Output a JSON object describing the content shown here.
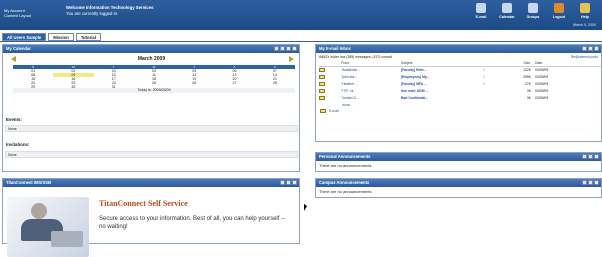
{
  "header": {
    "account_line1": "My Account",
    "account_line2": "Content Layout",
    "welcome_title": "Welcome Information Technology Services",
    "welcome_sub": "You are currently logged in.",
    "nav": [
      {
        "label": "E-mail",
        "icon": "email-icon",
        "color": "#c9d7ee"
      },
      {
        "label": "Calendar",
        "icon": "calendar-icon",
        "color": "#c9d7ee"
      },
      {
        "label": "Groups",
        "icon": "groups-icon",
        "color": "#c9d7ee"
      },
      {
        "label": "Logout",
        "icon": "logout-icon",
        "color": "#e08a2c"
      },
      {
        "label": "Help",
        "icon": "help-icon",
        "color": "#e9c24a"
      }
    ],
    "date": "March 9, 2009"
  },
  "tabs": [
    "All Users Sample",
    "Mission",
    "Tutorial"
  ],
  "calendar": {
    "title": "My Calendar",
    "month": "March 2009",
    "weekdays": [
      "S",
      "M",
      "T",
      "W",
      "T",
      "F",
      "S"
    ],
    "weeks": [
      [
        "01",
        "02",
        "03",
        "04",
        "05",
        "06",
        "07"
      ],
      [
        "08",
        "09",
        "10",
        "11",
        "12",
        "13",
        "14"
      ],
      [
        "15",
        "16",
        "17",
        "18",
        "19",
        "20",
        "21"
      ],
      [
        "22",
        "23",
        "24",
        "25",
        "26",
        "27",
        "28"
      ],
      [
        "29",
        "30",
        "31",
        "",
        "",
        "",
        ""
      ]
    ],
    "today_label": "Today is: 2009/03/09",
    "events_label": "Events:",
    "events_value": "None",
    "invitations_label": "Invitations:",
    "invitations_value": "None"
  },
  "inbox": {
    "title": "My E-mail Inbox",
    "info": "INBOX folder has (385) messages: (157) unread",
    "link": "Re@udmercy.edu",
    "columns": [
      "From:",
      "Subject:",
      "Size:",
      "Date:"
    ],
    "rows": [
      {
        "from": "\"Academic...",
        "subject": "[Faculty] Retir...",
        "flag": "!",
        "size": "122K",
        "date": "03/09/09"
      },
      {
        "from": "\"john sta...",
        "subject": "[Employees] My...",
        "flag": "!",
        "size": "259K",
        "date": "03/09/09"
      },
      {
        "from": "\"Heather ...",
        "subject": "[Faculty] MFA ...",
        "flag": "!",
        "size": "27K",
        "date": "03/09/09"
      },
      {
        "from": "\"ITS\" <it...",
        "subject": "Not read: UDM ...",
        "flag": "",
        "size": "3K",
        "date": "03/09/09"
      },
      {
        "from": "\"Jordan D...",
        "subject": "Bad Confirmati...",
        "flag": "",
        "size": "3K",
        "date": "03/09/09"
      }
    ],
    "more": "more...",
    "email_link": "E-mail"
  },
  "personal": {
    "title": "Personal Announcements",
    "text": "There are no announcements"
  },
  "campus": {
    "title": "Campus Announcements",
    "text": "There are no announcements"
  },
  "titan": {
    "title": "TitanConnect IMS/SSB",
    "heading": "TitanConnect Self Service",
    "desc": "Secure access to your information. Best of all, you can help yourself -- no waiting!"
  }
}
